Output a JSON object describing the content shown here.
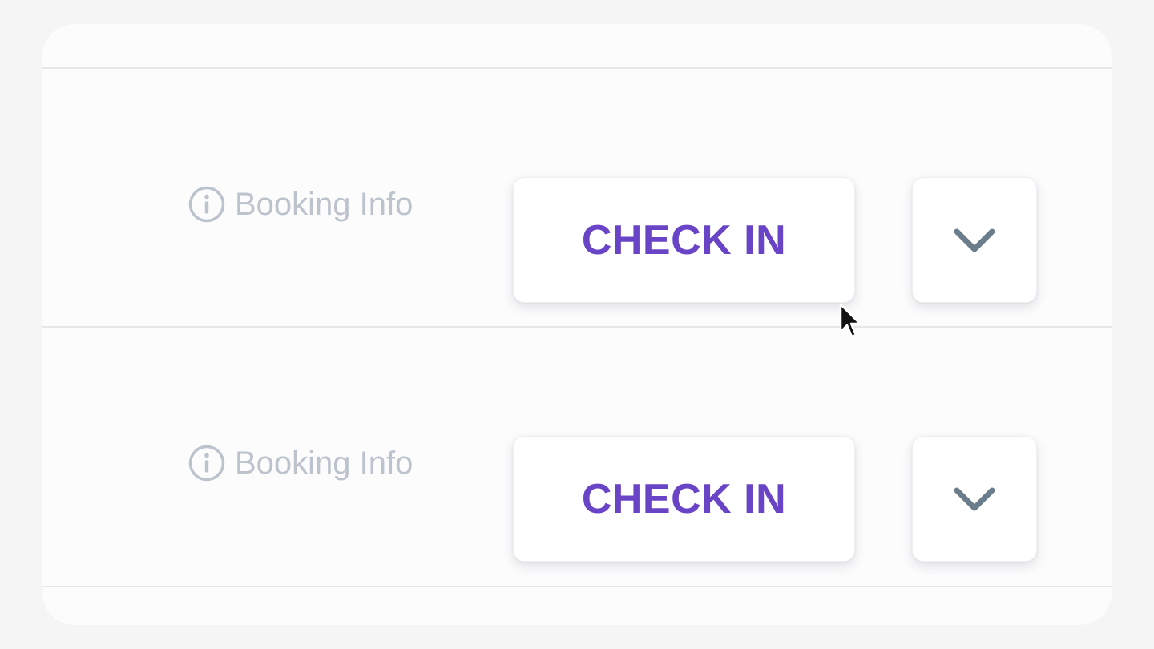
{
  "rows": [
    {
      "booking_info_label": "Booking Info",
      "check_in_label": "CHECK IN"
    },
    {
      "booking_info_label": "Booking Info",
      "check_in_label": "CHECK IN"
    }
  ],
  "icons": {
    "info": "info-circle-icon",
    "dropdown": "chevron-down-icon",
    "cursor": "mouse-pointer-icon"
  },
  "colors": {
    "page_background": "#f5f5f6",
    "card_background": "#fcfcfd",
    "check_in_text": "#6a44c7",
    "booking_info_text": "#bcc3cc",
    "chevron": "#6b7c8a",
    "divider": "#e6e7ea"
  }
}
